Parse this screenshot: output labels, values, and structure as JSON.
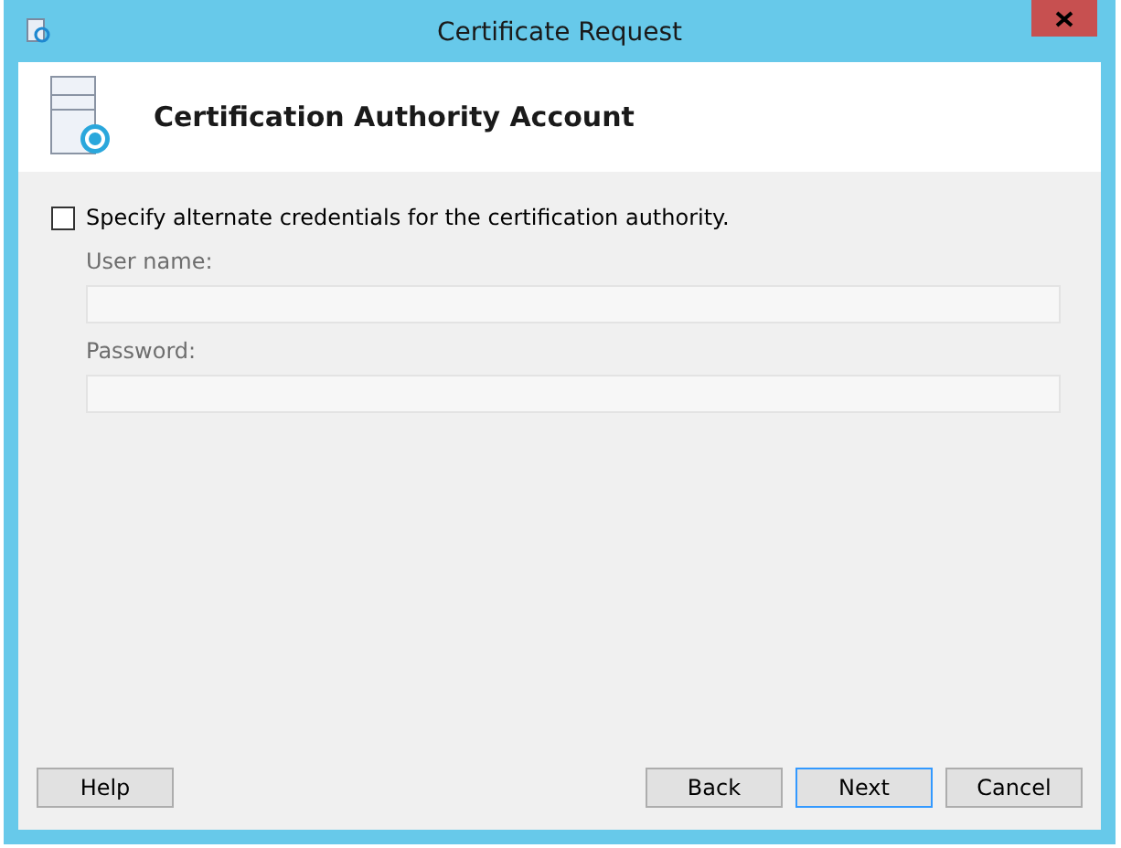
{
  "window": {
    "title": "Certificate Request"
  },
  "header": {
    "title": "Certification Authority Account"
  },
  "checkbox": {
    "label": "Specify alternate credentials for the certification authority.",
    "checked": false
  },
  "fields": [
    {
      "label": "User name:",
      "disabled": true
    },
    {
      "label": "Password:",
      "disabled": true
    }
  ],
  "buttons": [
    {
      "label": "Help",
      "default": false
    },
    {
      "label": "Back",
      "default": false
    },
    {
      "label": "Next",
      "default": true
    },
    {
      "label": "Cancel",
      "default": false
    }
  ]
}
